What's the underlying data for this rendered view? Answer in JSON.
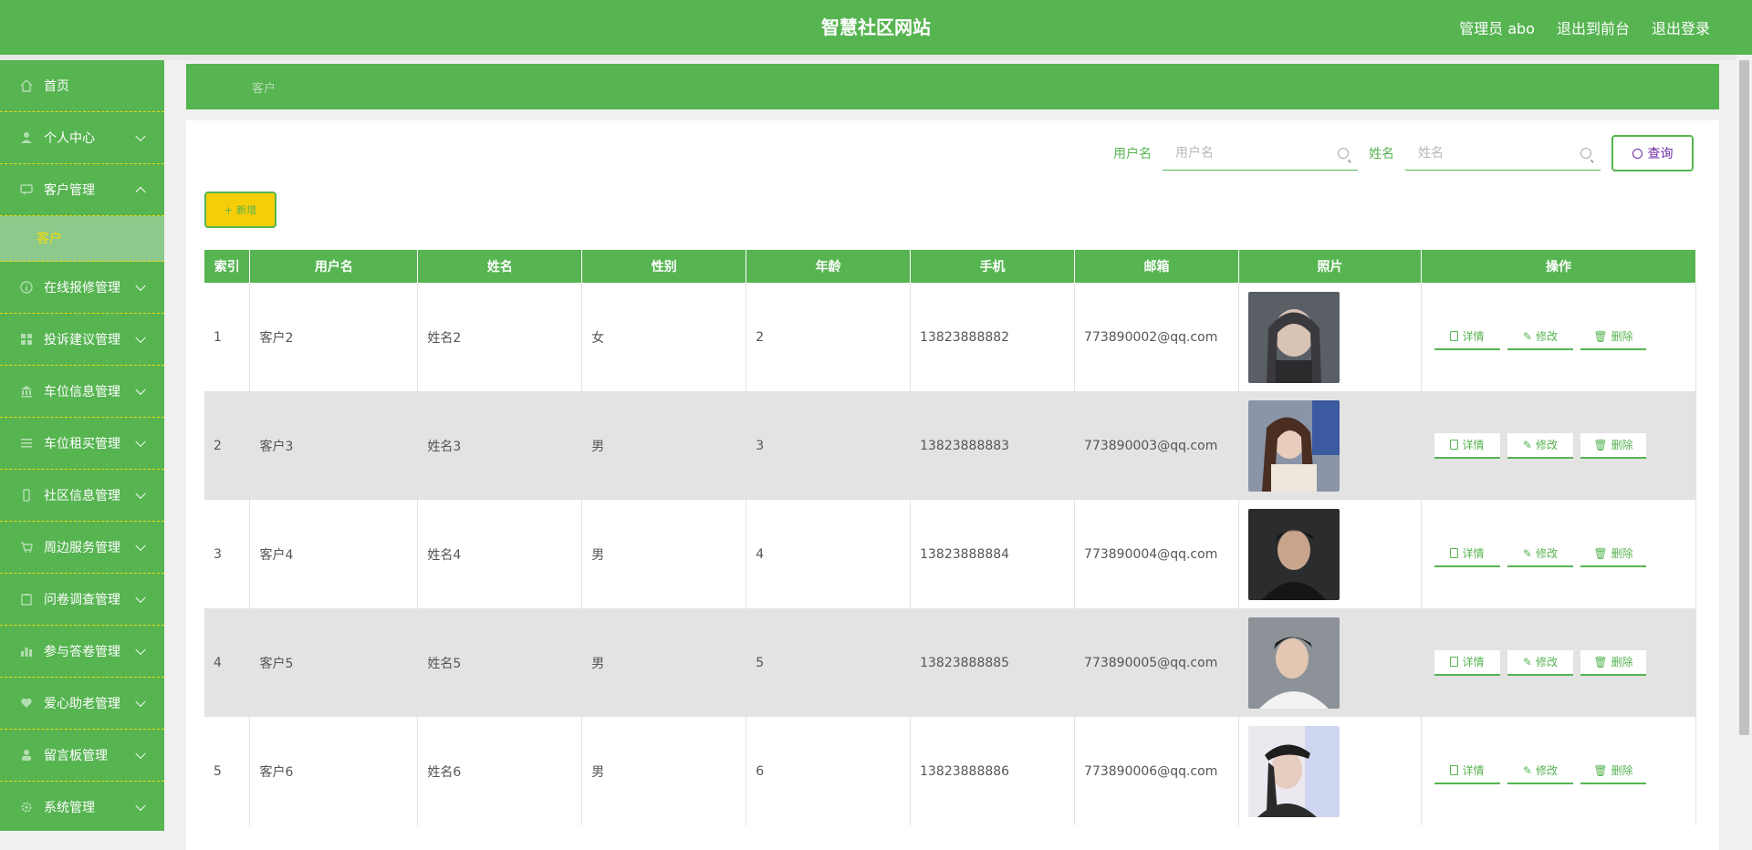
{
  "header": {
    "title": "智慧社区网站",
    "user": "管理员 abo",
    "to_front": "退出到前台",
    "logout": "退出登录"
  },
  "sidebar": {
    "items": [
      {
        "label": "首页",
        "icon": "home-icon",
        "chevron": "none"
      },
      {
        "label": "个人中心",
        "icon": "user-icon",
        "chevron": "down"
      },
      {
        "label": "客户管理",
        "icon": "chat-icon",
        "chevron": "up"
      },
      {
        "label": "在线报修管理",
        "icon": "info-icon",
        "chevron": "down"
      },
      {
        "label": "投诉建议管理",
        "icon": "grid-icon",
        "chevron": "down"
      },
      {
        "label": "车位信息管理",
        "icon": "bank-icon",
        "chevron": "down"
      },
      {
        "label": "车位租买管理",
        "icon": "list-icon",
        "chevron": "down"
      },
      {
        "label": "社区信息管理",
        "icon": "phone-icon",
        "chevron": "down"
      },
      {
        "label": "周边服务管理",
        "icon": "cart-icon",
        "chevron": "down"
      },
      {
        "label": "问卷调查管理",
        "icon": "clipboard-icon",
        "chevron": "down"
      },
      {
        "label": "参与答卷管理",
        "icon": "chart-icon",
        "chevron": "down"
      },
      {
        "label": "爱心助老管理",
        "icon": "heart-icon",
        "chevron": "down"
      },
      {
        "label": "留言板管理",
        "icon": "person-icon",
        "chevron": "down"
      },
      {
        "label": "系统管理",
        "icon": "gear-icon",
        "chevron": "down"
      }
    ],
    "active_sub": "客户"
  },
  "breadcrumb": "客户",
  "search": {
    "username_label": "用户名",
    "username_placeholder": "用户名",
    "name_label": "姓名",
    "name_placeholder": "姓名",
    "query_label": "查询"
  },
  "add_label": "新增",
  "table": {
    "headers": [
      "索引",
      "用户名",
      "姓名",
      "性别",
      "年龄",
      "手机",
      "邮箱",
      "照片",
      "操作"
    ],
    "rows": [
      {
        "index": "1",
        "username": "客户2",
        "name": "姓名2",
        "gender": "女",
        "age": "2",
        "phone": "13823888882",
        "email": "773890002@qq.com"
      },
      {
        "index": "2",
        "username": "客户3",
        "name": "姓名3",
        "gender": "男",
        "age": "3",
        "phone": "13823888883",
        "email": "773890003@qq.com"
      },
      {
        "index": "3",
        "username": "客户4",
        "name": "姓名4",
        "gender": "男",
        "age": "4",
        "phone": "13823888884",
        "email": "773890004@qq.com"
      },
      {
        "index": "4",
        "username": "客户5",
        "name": "姓名5",
        "gender": "男",
        "age": "5",
        "phone": "13823888885",
        "email": "773890005@qq.com"
      },
      {
        "index": "5",
        "username": "客户6",
        "name": "姓名6",
        "gender": "男",
        "age": "6",
        "phone": "13823888886",
        "email": "773890006@qq.com"
      }
    ],
    "ops": {
      "detail": "详情",
      "edit": "修改",
      "delete": "删除"
    }
  },
  "colors": {
    "primary": "#56b451",
    "accent": "#f5cd09",
    "query_text": "#6a2aa0"
  }
}
